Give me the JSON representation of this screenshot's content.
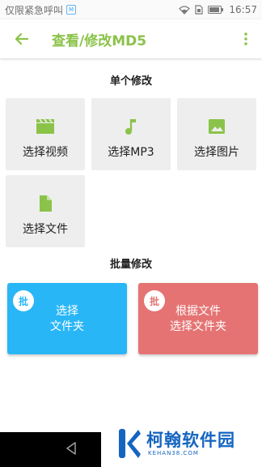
{
  "status_bar": {
    "carrier_text": "仅限紧急呼叫",
    "badge_text": "M",
    "time": "16:57"
  },
  "app_bar": {
    "title": "查看/修改MD5",
    "accent_color": "#8bc34a"
  },
  "single_section": {
    "title": "单个修改",
    "tiles": [
      {
        "label": "选择视频",
        "icon": "video-clapper-icon"
      },
      {
        "label": "选择MP3",
        "icon": "music-note-icon"
      },
      {
        "label": "选择图片",
        "icon": "image-icon"
      },
      {
        "label": "选择文件",
        "icon": "file-icon"
      }
    ]
  },
  "batch_section": {
    "title": "批量修改",
    "cards": [
      {
        "badge": "批",
        "line1": "选择",
        "line2": "文件夹",
        "color": "#29b6f6"
      },
      {
        "badge": "批",
        "line1": "根据文件",
        "line2": "选择文件夹",
        "color": "#e57373"
      }
    ]
  },
  "watermark": {
    "name": "柯翰软件园",
    "url": "KEHAN38.COM"
  }
}
